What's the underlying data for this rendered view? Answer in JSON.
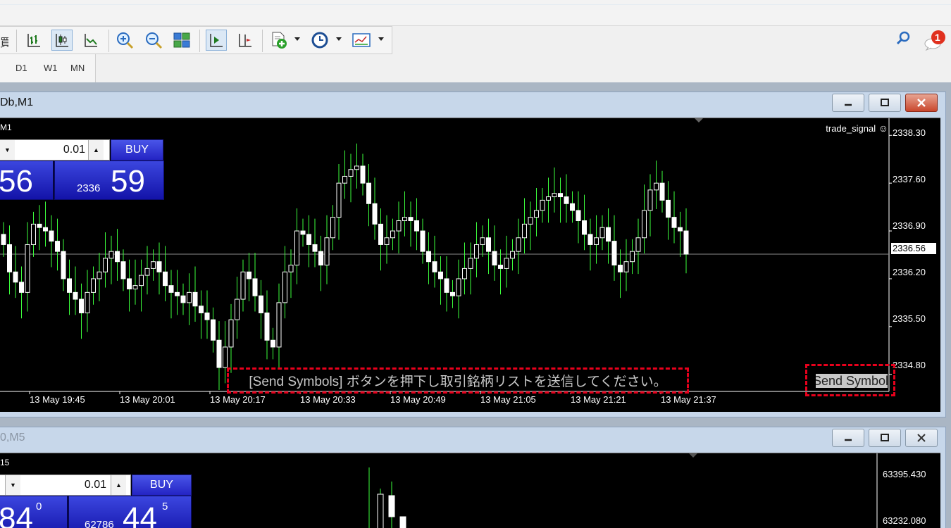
{
  "toolbar": {
    "cut_glyph": "買",
    "timeframes": [
      "D1",
      "W1",
      "MN"
    ]
  },
  "notifications": {
    "count": "1"
  },
  "window1": {
    "title": "Db,M1",
    "chart_label": "M1",
    "indicator_label": "trade_signal",
    "panel": {
      "lot": "0.01",
      "buy_label": "BUY",
      "sell_big": "56",
      "buy_prefix": "2336",
      "buy_big": "59"
    },
    "price_axis": [
      "2338.30",
      "2337.60",
      "2336.90",
      "2336.56",
      "2336.20",
      "2335.50",
      "2334.80"
    ],
    "current_price": "2336.56",
    "time_axis": [
      "13 May 19:45",
      "13 May 20:01",
      "13 May 20:17",
      "13 May 20:33",
      "13 May 20:49",
      "13 May 21:05",
      "13 May 21:21",
      "13 May 21:37"
    ],
    "status_message": "[Send Symbols] ボタンを押下し取引銘柄リストを送信してください。",
    "send_button_label": "Send Symbols"
  },
  "window2": {
    "title": "0,M5",
    "chart_label": "15",
    "panel": {
      "lot": "0.01",
      "buy_label": "BUY",
      "sell_big": "84",
      "sell_sup": "0",
      "buy_prefix": "62786",
      "buy_big": "44",
      "buy_sup": "5"
    },
    "price_axis": [
      "63395.430",
      "63232.080"
    ]
  },
  "chart_data": [
    {
      "type": "candlestick",
      "title": "",
      "xlabel": "",
      "ylabel": "",
      "ylim": [
        2334.55,
        2338.55
      ],
      "x": [
        "13 May 19:45",
        "13 May 20:01",
        "13 May 20:17",
        "13 May 20:33",
        "13 May 20:49",
        "13 May 21:05",
        "13 May 21:21",
        "13 May 21:37"
      ],
      "price_ticks": [
        2338.3,
        2337.6,
        2336.9,
        2336.2,
        2335.5,
        2334.8
      ],
      "current_price": 2336.56,
      "candle_color_up": "#000000",
      "candle_outline": "#ffffff",
      "wick_color": "#3cff3c",
      "close_series": [
        2336.7,
        2336.3,
        2336.15,
        2336.0,
        2336.7,
        2337.0,
        2336.95,
        2336.9,
        2336.75,
        2336.6,
        2336.2,
        2336.0,
        2335.9,
        2335.7,
        2336.0,
        2336.2,
        2336.3,
        2336.5,
        2336.6,
        2336.45,
        2336.2,
        2336.05,
        2336.1,
        2336.25,
        2336.35,
        2336.45,
        2336.3,
        2336.1,
        2336.0,
        2335.95,
        2335.85,
        2336.0,
        2335.8,
        2335.7,
        2335.6,
        2335.3,
        2334.9,
        2335.2,
        2335.6,
        2335.9,
        2336.3,
        2336.2,
        2335.95,
        2335.7,
        2335.3,
        2335.2,
        2335.85,
        2336.3,
        2336.4,
        2336.9,
        2336.85,
        2336.7,
        2336.6,
        2336.4,
        2336.8,
        2337.1,
        2337.6,
        2337.7,
        2337.8,
        2337.85,
        2337.6,
        2337.3,
        2337.0,
        2336.7,
        2336.8,
        2336.9,
        2337.05,
        2337.1,
        2337.05,
        2336.9,
        2336.6,
        2336.45,
        2336.3,
        2336.2,
        2336.0,
        2335.95,
        2336.2,
        2336.35,
        2336.5,
        2336.7,
        2336.8,
        2336.6,
        2336.4,
        2336.35,
        2336.5,
        2336.6,
        2336.8,
        2337.0,
        2337.1,
        2337.2,
        2337.35,
        2337.4,
        2337.45,
        2337.4,
        2337.3,
        2337.2,
        2337.05,
        2336.85,
        2336.7,
        2336.8,
        2336.95,
        2336.75,
        2336.4,
        2336.3,
        2336.45,
        2336.6,
        2336.8,
        2337.2,
        2337.5,
        2337.6,
        2337.35,
        2337.1,
        2336.95,
        2336.9,
        2336.56
      ]
    }
  ]
}
